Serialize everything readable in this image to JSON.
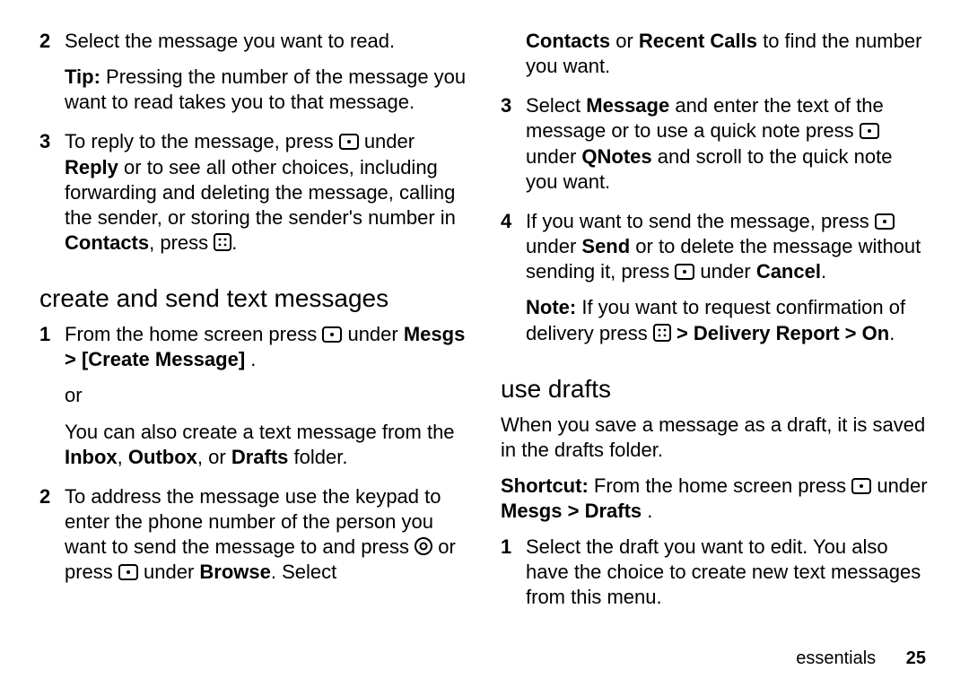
{
  "left": {
    "items": [
      {
        "num": "2",
        "p1_a": "Select the message you want to read.",
        "p2_a": "Tip:",
        "p2_b": " Pressing the number of the message you want to read takes you to that message."
      },
      {
        "num": "3",
        "p1_a": "To reply to the message, press ",
        "p1_b": " under ",
        "p1_c": "Reply",
        "p1_d": " or to see all other choices, including forwarding and deleting the message, calling the sender, or storing the sender's number in ",
        "p1_e": "Contacts",
        "p1_f": ", press ",
        "p1_g": "."
      }
    ],
    "heading": "create and send text messages",
    "items2": [
      {
        "num": "1",
        "p1_a": "From the home screen press ",
        "p1_b": " under ",
        "p1_c": "Mesgs",
        "p1_d": " > ",
        "p1_e": "[Create Message]",
        "p1_f": " .",
        "p2": "or",
        "p3_a": "You can also create a text message from the ",
        "p3_b": "Inbox",
        "p3_c": ", ",
        "p3_d": "Outbox",
        "p3_e": ", or ",
        "p3_f": "Drafts",
        "p3_g": " folder."
      },
      {
        "num": "2",
        "p1_a": "To address the message use the keypad to enter the phone number of the person you want to send the message to and press ",
        "p1_b": " or press ",
        "p1_c": " under ",
        "p1_d": "Browse",
        "p1_e": ". Select"
      }
    ]
  },
  "right": {
    "cont_a": "Contacts",
    "cont_b": " or ",
    "cont_c": "Recent Calls",
    "cont_d": " to find the number you want.",
    "items": [
      {
        "num": "3",
        "p1_a": "Select ",
        "p1_b": "Message",
        "p1_c": " and enter the text of the message or to use a quick note press ",
        "p1_d": " under ",
        "p1_e": "QNotes",
        "p1_f": " and scroll to the quick note you want."
      },
      {
        "num": "4",
        "p1_a": "If you want to send the message, press ",
        "p1_b": " under ",
        "p1_c": "Send",
        "p1_d": " or to delete the message without sending it, press ",
        "p1_e": " under ",
        "p1_f": "Cancel",
        "p1_g": ".",
        "p2_a": "Note:",
        "p2_b": " If you want to request confirmation of delivery press ",
        "p2_c": " > ",
        "p2_d": "Delivery Report",
        "p2_e": " > ",
        "p2_f": "On",
        "p2_g": "."
      }
    ],
    "heading": "use drafts",
    "para1": "When you save a message as a draft, it is saved in the drafts folder.",
    "para2_a": "Shortcut:",
    "para2_b": " From the home screen press ",
    "para2_c": " under ",
    "para2_d": "Mesgs",
    "para2_e": " > ",
    "para2_f": "Drafts",
    "para2_g": " .",
    "items2": [
      {
        "num": "1",
        "p1": "Select the draft you want to edit. You also have the choice to create new text messages from this menu."
      }
    ]
  },
  "footer": {
    "section": "essentials",
    "page": "25"
  }
}
